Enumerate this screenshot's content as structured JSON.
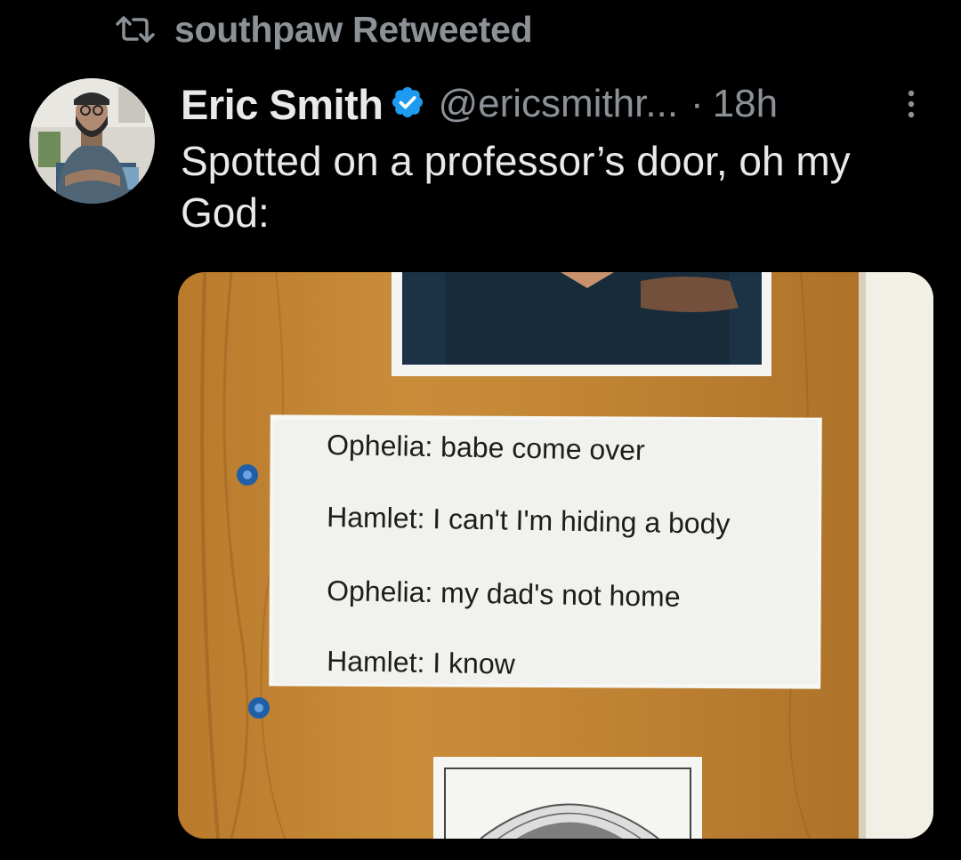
{
  "retweet": {
    "icon": "retweet-icon",
    "text": "southpaw Retweeted"
  },
  "tweet": {
    "author": {
      "display_name": "Eric Smith",
      "verified_icon": "verified-badge-icon",
      "handle": "@ericsmithr...",
      "avatar": "profile-photo"
    },
    "separator": "·",
    "time": "18h",
    "more_icon": "more-vertical-icon",
    "text": "Spotted on a professor’s door, oh my God:",
    "photo": {
      "note_lines": [
        "Ophelia: babe come over",
        "Hamlet: I can't I'm hiding a body",
        "Ophelia: my dad's not home",
        "Hamlet: I know"
      ]
    }
  },
  "colors": {
    "background": "#000000",
    "primary_text": "#e7e9ea",
    "secondary_text": "#8b9197",
    "verified_blue": "#1d9bf0"
  }
}
